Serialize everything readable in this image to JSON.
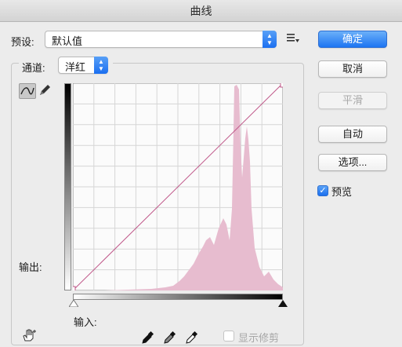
{
  "window": {
    "title": "曲线"
  },
  "preset": {
    "label": "预设:",
    "value": "默认值"
  },
  "channel": {
    "label": "通道:",
    "value": "洋红"
  },
  "buttons": {
    "ok": "确定",
    "cancel": "取消",
    "smooth": "平滑",
    "auto": "自动",
    "options": "选项..."
  },
  "preview": {
    "label": "预览",
    "checked": true
  },
  "axes": {
    "output_label": "输出:",
    "input_label": "输入:"
  },
  "show_clipping": {
    "label": "显示修剪",
    "checked": false
  },
  "colors": {
    "accent": "#1d75f2",
    "histogram": "#e7bccf",
    "curve": "#c0588a"
  }
}
